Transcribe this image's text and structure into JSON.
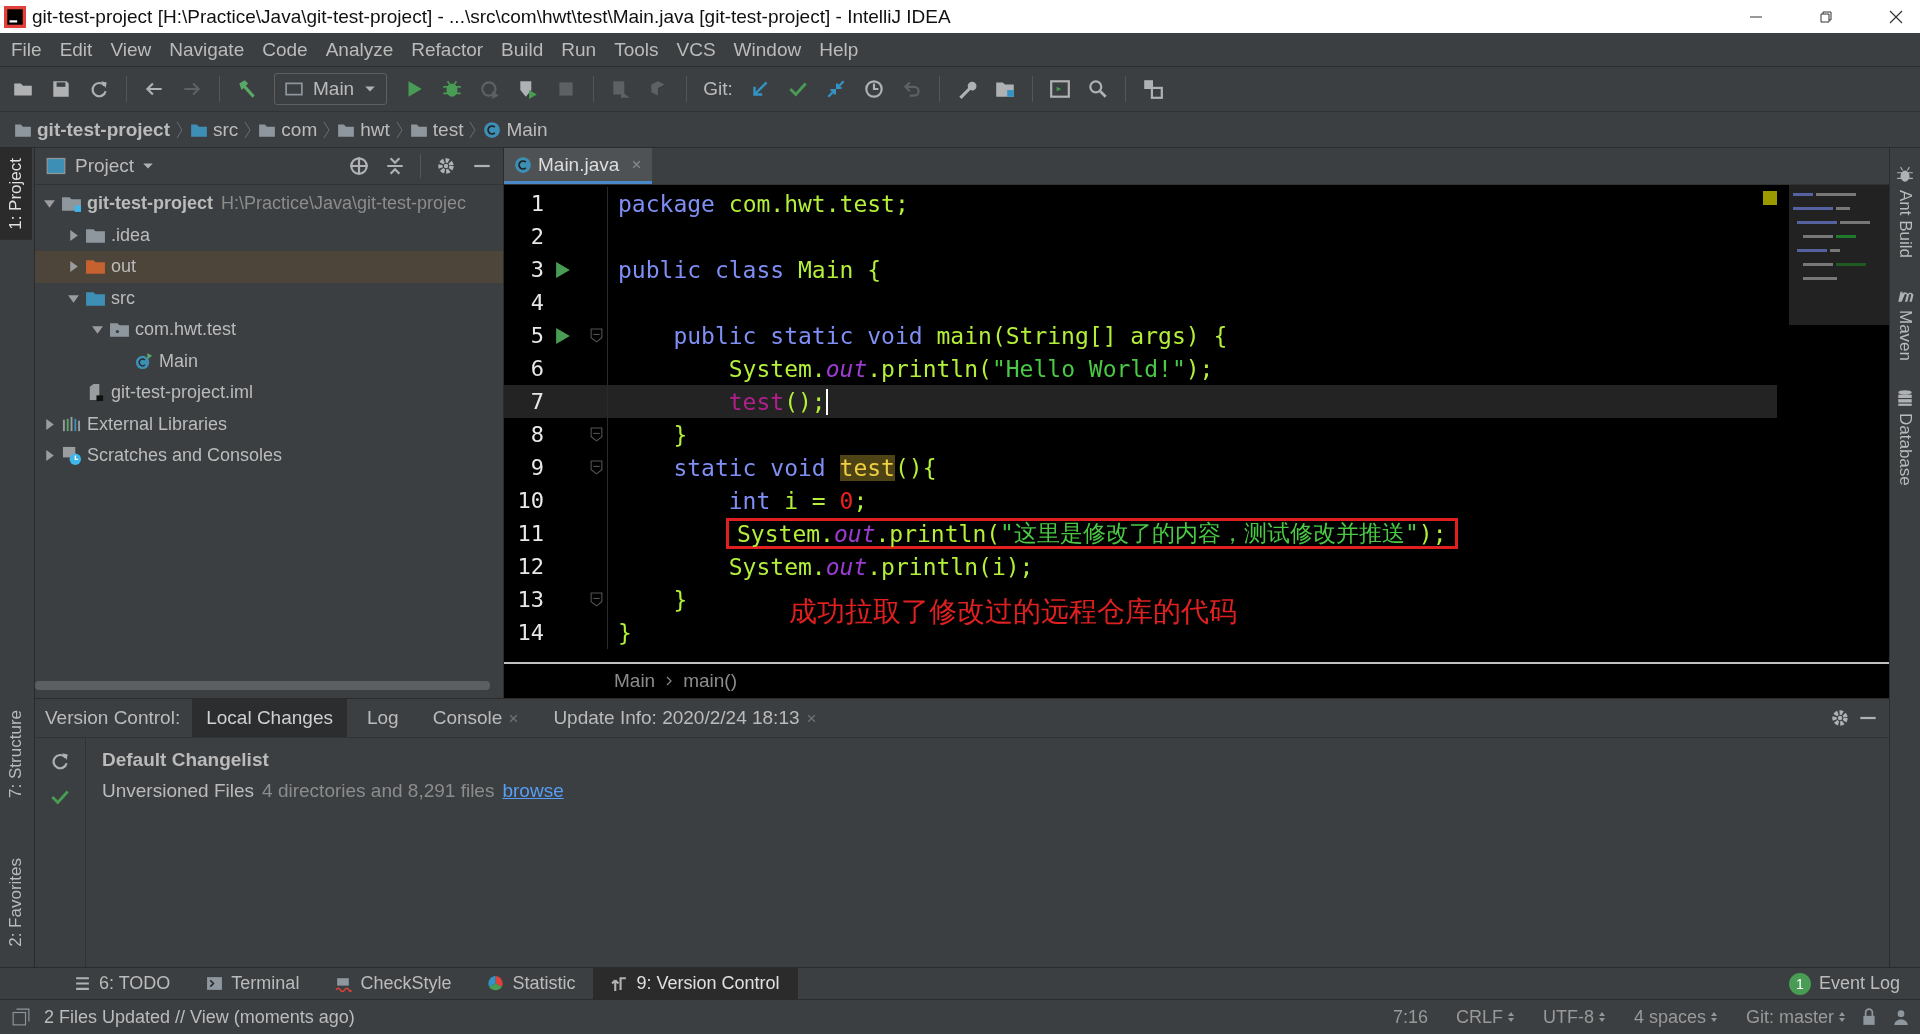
{
  "window": {
    "title": "git-test-project [H:\\Practice\\Java\\git-test-project] - ...\\src\\com\\hwt\\test\\Main.java [git-test-project] - IntelliJ IDEA"
  },
  "menu": [
    "File",
    "Edit",
    "View",
    "Navigate",
    "Code",
    "Analyze",
    "Refactor",
    "Build",
    "Run",
    "Tools",
    "VCS",
    "Window",
    "Help"
  ],
  "toolbar": {
    "run_config": "Main",
    "git_label": "Git:"
  },
  "breadcrumbs": [
    {
      "label": "git-test-project",
      "kind": "project"
    },
    {
      "label": "src",
      "kind": "folder"
    },
    {
      "label": "com",
      "kind": "package"
    },
    {
      "label": "hwt",
      "kind": "package"
    },
    {
      "label": "test",
      "kind": "package"
    },
    {
      "label": "Main",
      "kind": "class"
    }
  ],
  "left_strip": {
    "top": [
      {
        "label": "1: Project",
        "selected": true
      }
    ],
    "bottom": [
      {
        "label": "7: Structure",
        "selected": false
      },
      {
        "label": "2: Favorites",
        "selected": false
      }
    ]
  },
  "project_panel": {
    "title": "Project",
    "tree": [
      {
        "label": "git-test-project",
        "path": "H:\\Practice\\Java\\git-test-projec",
        "kind": "module",
        "expanded": true,
        "selected": false,
        "children": [
          {
            "label": ".idea",
            "kind": "folder",
            "expanded": false,
            "selected": false
          },
          {
            "label": "out",
            "kind": "excluded",
            "expanded": false,
            "selected": true
          },
          {
            "label": "src",
            "kind": "source",
            "expanded": true,
            "selected": false,
            "children": [
              {
                "label": "com.hwt.test",
                "kind": "package",
                "expanded": true,
                "selected": false,
                "children": [
                  {
                    "label": "Main",
                    "kind": "class",
                    "selected": false
                  }
                ]
              }
            ]
          },
          {
            "label": "git-test-project.iml",
            "kind": "file",
            "selected": false
          }
        ]
      },
      {
        "label": "External Libraries",
        "kind": "libraries",
        "expanded": false,
        "selected": false
      },
      {
        "label": "Scratches and Consoles",
        "kind": "scratches",
        "expanded": false,
        "selected": false
      }
    ]
  },
  "editor": {
    "tab": {
      "label": "Main.java",
      "selected": true
    },
    "lines": [
      {
        "number": "1",
        "run": false,
        "fold": false,
        "current": false,
        "tokens": [
          {
            "kind": "keyword",
            "text": "package"
          },
          {
            "kind": "text",
            "text": " com.hwt.test;"
          }
        ]
      },
      {
        "number": "2",
        "run": false,
        "fold": false,
        "current": false
      },
      {
        "number": "3",
        "run": true,
        "fold": false,
        "current": false,
        "tokens": [
          {
            "kind": "keyword",
            "text": "public class"
          },
          {
            "kind": "text",
            "text": " Main {"
          }
        ]
      },
      {
        "number": "4",
        "run": false,
        "fold": false,
        "current": false
      },
      {
        "number": "5",
        "run": true,
        "fold": true,
        "current": false,
        "tokens": [
          {
            "kind": "keyword",
            "text": "    public static void"
          },
          {
            "kind": "text",
            "text": " main(String[] args) {"
          }
        ]
      },
      {
        "number": "6",
        "run": false,
        "fold": false,
        "current": false,
        "tokens": [
          {
            "kind": "text",
            "text": "        System."
          },
          {
            "kind": "field",
            "text": "out"
          },
          {
            "kind": "text",
            "text": ".println("
          },
          {
            "kind": "string",
            "text": "\"Hello World!\""
          },
          {
            "kind": "text",
            "text": ");"
          }
        ]
      },
      {
        "number": "7",
        "run": false,
        "fold": false,
        "current": true,
        "tokens": [
          {
            "kind": "call",
            "text": "        test"
          },
          {
            "kind": "text",
            "text": "();"
          }
        ]
      },
      {
        "number": "8",
        "run": false,
        "fold": true,
        "current": false,
        "tokens": [
          {
            "kind": "text",
            "text": "    }"
          }
        ]
      },
      {
        "number": "9",
        "run": false,
        "fold": true,
        "current": false,
        "tokens": [
          {
            "kind": "keyword",
            "text": "    static void "
          },
          {
            "kind": "usage",
            "text": "test"
          },
          {
            "kind": "text",
            "text": "(){"
          }
        ]
      },
      {
        "number": "10",
        "run": false,
        "fold": false,
        "current": false,
        "tokens": [
          {
            "kind": "keyword",
            "text": "        int"
          },
          {
            "kind": "text",
            "text": " i = "
          },
          {
            "kind": "number",
            "text": "0"
          },
          {
            "kind": "text",
            "text": ";"
          }
        ]
      },
      {
        "number": "11",
        "run": false,
        "fold": false,
        "current": false,
        "boxed": true,
        "tokens": [
          {
            "kind": "text",
            "text": "System."
          },
          {
            "kind": "field",
            "text": "out"
          },
          {
            "kind": "text",
            "text": ".println("
          },
          {
            "kind": "string",
            "text": "\"这里是修改了的内容，测试修改并推送\""
          },
          {
            "kind": "text",
            "text": ");"
          }
        ]
      },
      {
        "number": "12",
        "run": false,
        "fold": false,
        "current": false,
        "tokens": [
          {
            "kind": "text",
            "text": "        System."
          },
          {
            "kind": "field",
            "text": "out"
          },
          {
            "kind": "text",
            "text": ".println(i);"
          }
        ]
      },
      {
        "number": "13",
        "run": false,
        "fold": true,
        "current": false,
        "tokens": [
          {
            "kind": "text",
            "text": "    }"
          }
        ]
      },
      {
        "number": "14",
        "run": false,
        "fold": false,
        "current": false,
        "tokens": [
          {
            "kind": "text",
            "text": "}"
          }
        ]
      }
    ],
    "annotation": "成功拉取了修改过的远程仓库的代码",
    "breadcrumb": [
      "Main",
      "main()"
    ]
  },
  "right_strip": [
    "Ant Build",
    "Maven",
    "Database"
  ],
  "version_control": {
    "title": "Version Control:",
    "tabs": [
      {
        "label": "Local Changes",
        "selected": true,
        "closable": false
      },
      {
        "label": "Log",
        "selected": false,
        "closable": false
      },
      {
        "label": "Console",
        "selected": false,
        "closable": true
      },
      {
        "label": "Update Info: 2020/2/24 18:13",
        "selected": false,
        "closable": true
      }
    ],
    "changelist": "Default Changelist",
    "unversioned": {
      "label": "Unversioned Files",
      "detail": "4 directories and 8,291 files",
      "link": "browse"
    }
  },
  "bottom_tabs": [
    {
      "label": "6: TODO",
      "kind": "todo",
      "selected": false
    },
    {
      "label": "Terminal",
      "kind": "terminal",
      "selected": false
    },
    {
      "label": "CheckStyle",
      "kind": "checkstyle",
      "selected": false
    },
    {
      "label": "Statistic",
      "kind": "statistic",
      "selected": false
    },
    {
      "label": "9: Version Control",
      "kind": "vcs",
      "selected": true
    }
  ],
  "event_log": {
    "label": "Event Log",
    "count": "1"
  },
  "status_bar": {
    "message": "2 Files Updated // View (moments ago)",
    "position": "7:16",
    "line_separator": "CRLF",
    "encoding": "UTF-8",
    "indent": "4 spaces",
    "branch": "Git: master"
  }
}
